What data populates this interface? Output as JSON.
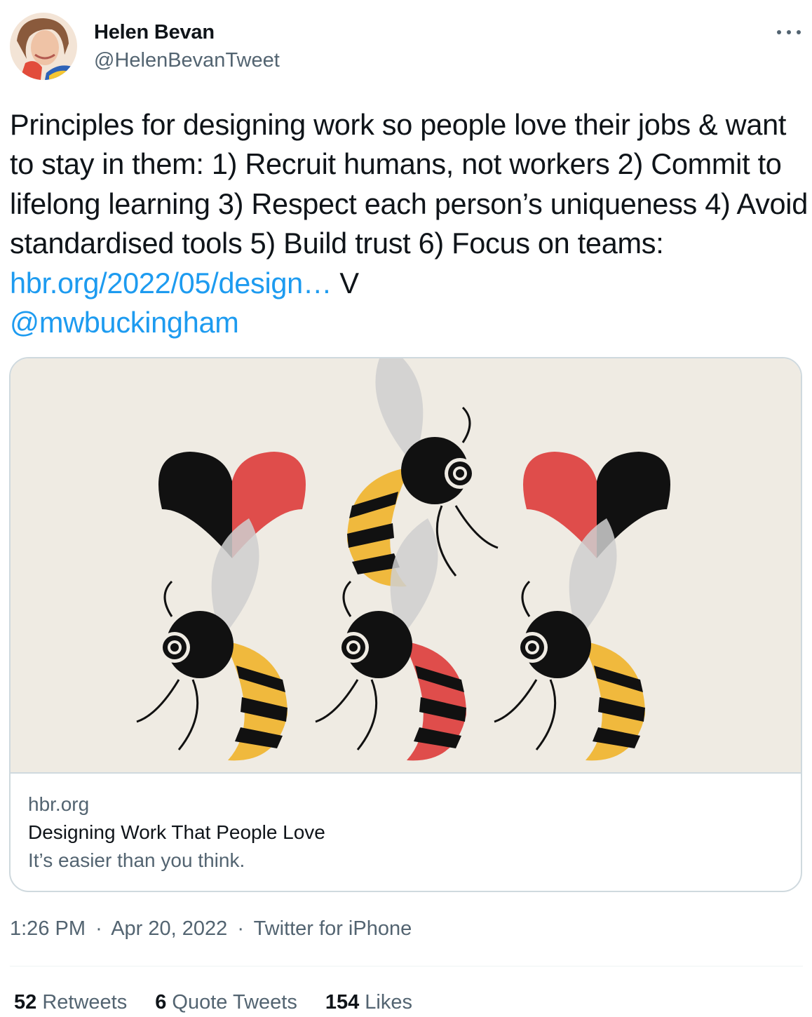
{
  "author": {
    "name": "Helen Bevan",
    "handle": "@HelenBevanTweet"
  },
  "tweet": {
    "text": "Principles for designing work so people love their jobs & want to stay in them: 1) Recruit humans, not workers 2) Commit to lifelong learning 3) Respect each person’s uniqueness 4) Avoid standardised tools 5) Build trust 6) Focus on teams: ",
    "link_text": "hbr.org/2022/05/design…",
    "after_link": " V",
    "mention": "@mwbuckingham"
  },
  "card": {
    "domain": "hbr.org",
    "title": "Designing Work That People Love",
    "description": "It’s easier than you think."
  },
  "meta": {
    "time": "1:26 PM",
    "separator": "·",
    "date": "Apr 20, 2022",
    "source": "Twitter for iPhone"
  },
  "stats": {
    "retweets_count": "52",
    "retweets_label": "Retweets",
    "quotes_count": "6",
    "quotes_label": "Quote Tweets",
    "likes_count": "154",
    "likes_label": "Likes"
  },
  "colors": {
    "link": "#1d9bf0",
    "secondary_text": "#536471",
    "bee_yellow": "#f0b93d",
    "heart_red": "#df4d4b",
    "card_background": "#efebe3"
  },
  "icons": {
    "more": "more-dots-icon"
  }
}
